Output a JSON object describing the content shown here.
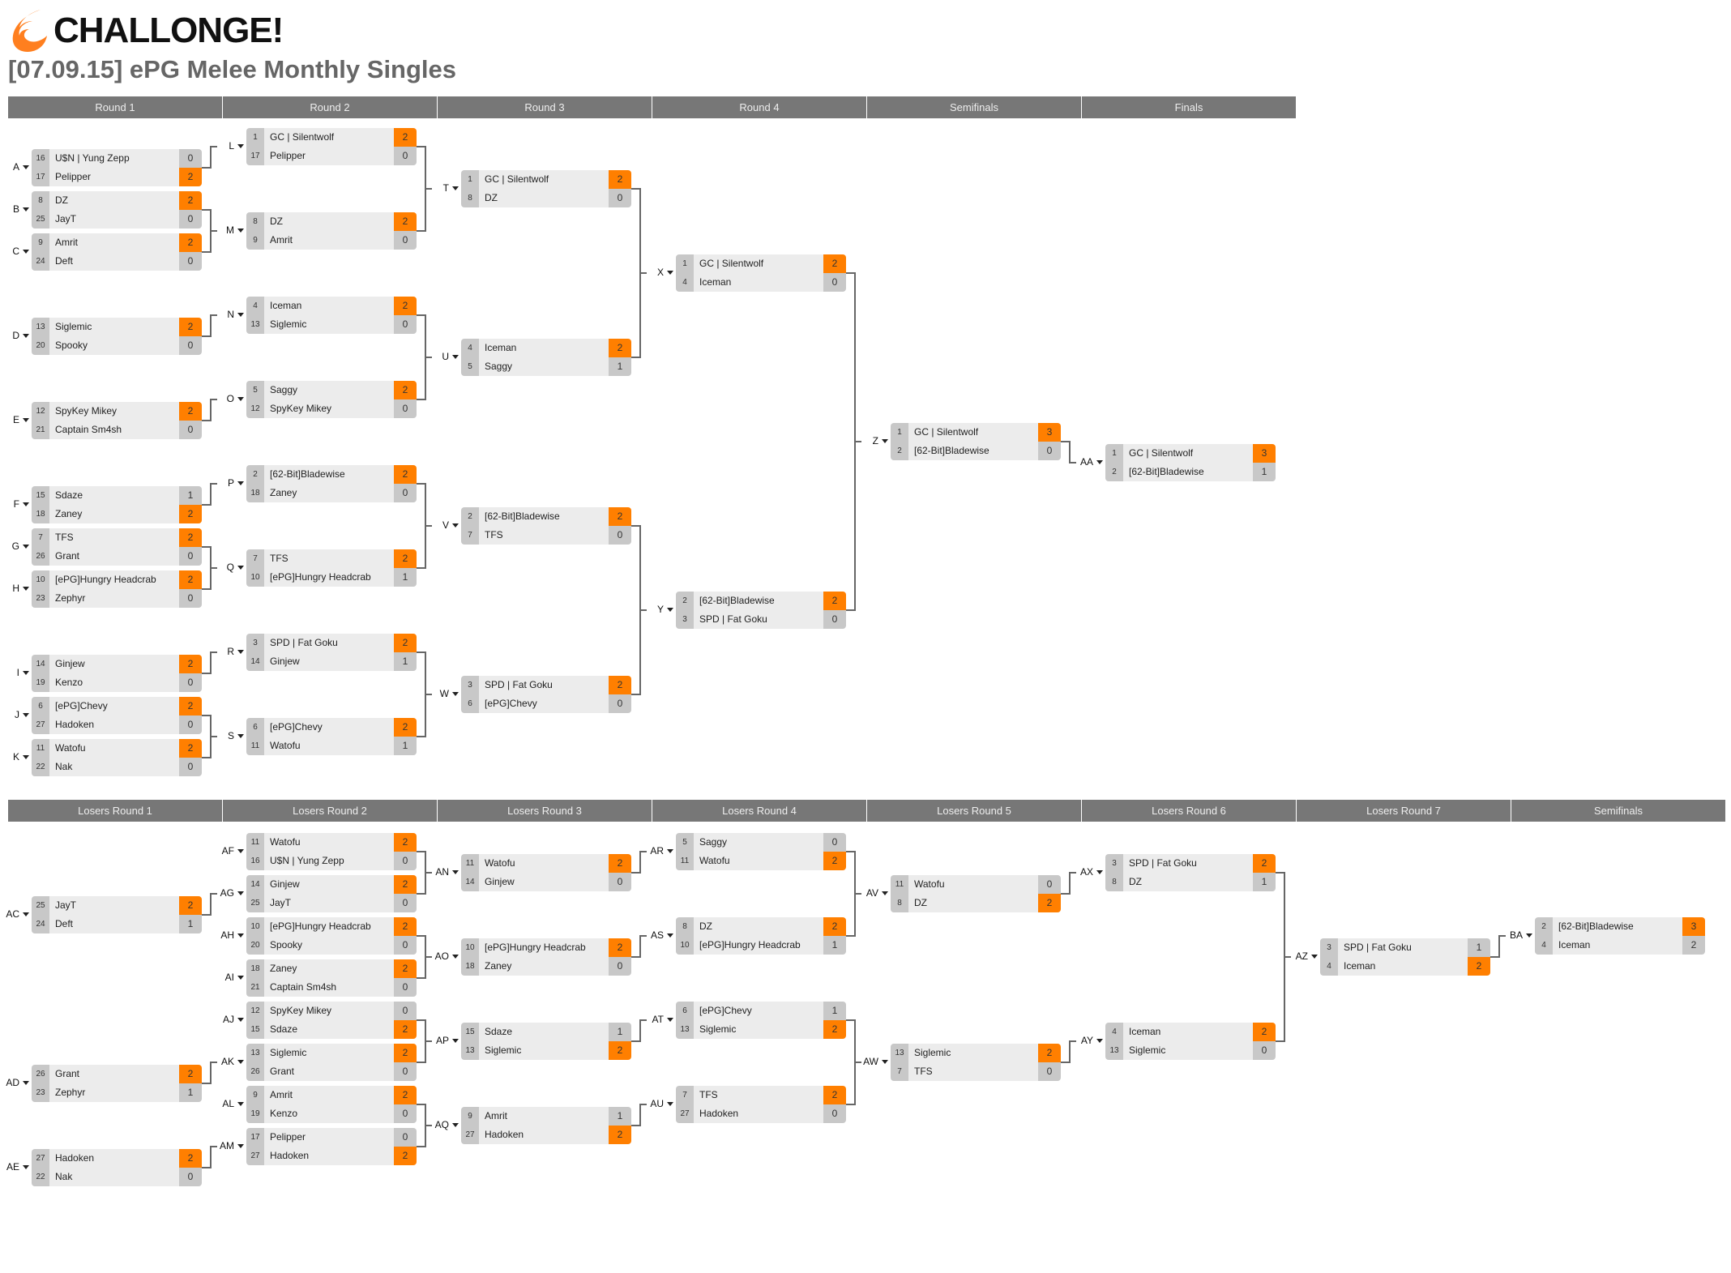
{
  "brand": {
    "name": "CHALLONGE!",
    "icon": "challonge-flame-logo-icon",
    "accent": "#ff7f00"
  },
  "tournament_title": "[07.09.15] ePG Melee Monthly Singles",
  "colors": {
    "header_bg": "#777777",
    "winner_score_bg": "#ff7f00",
    "seed_bg": "#c8c8c8",
    "name_bg": "#ececec"
  },
  "winners": {
    "rounds": [
      "Round 1",
      "Round 2",
      "Round 3",
      "Round 4",
      "Semifinals",
      "Finals"
    ],
    "matches": [
      {
        "id": "A",
        "round": 0,
        "p1": {
          "seed": 16,
          "name": "U$N | Yung Zepp",
          "score": 0
        },
        "p2": {
          "seed": 17,
          "name": "Pelipper",
          "score": 2
        },
        "winner": 2
      },
      {
        "id": "B",
        "round": 0,
        "p1": {
          "seed": 8,
          "name": "DZ",
          "score": 2
        },
        "p2": {
          "seed": 25,
          "name": "JayT",
          "score": 0
        },
        "winner": 1
      },
      {
        "id": "C",
        "round": 0,
        "p1": {
          "seed": 9,
          "name": "Amrit",
          "score": 2
        },
        "p2": {
          "seed": 24,
          "name": "Deft",
          "score": 0
        },
        "winner": 1
      },
      {
        "id": "D",
        "round": 0,
        "p1": {
          "seed": 13,
          "name": "Siglemic",
          "score": 2
        },
        "p2": {
          "seed": 20,
          "name": "Spooky",
          "score": 0
        },
        "winner": 1
      },
      {
        "id": "E",
        "round": 0,
        "p1": {
          "seed": 12,
          "name": "SpyKey Mikey",
          "score": 2
        },
        "p2": {
          "seed": 21,
          "name": "Captain Sm4sh",
          "score": 0
        },
        "winner": 1
      },
      {
        "id": "F",
        "round": 0,
        "p1": {
          "seed": 15,
          "name": "Sdaze",
          "score": 1
        },
        "p2": {
          "seed": 18,
          "name": "Zaney",
          "score": 2
        },
        "winner": 2
      },
      {
        "id": "G",
        "round": 0,
        "p1": {
          "seed": 7,
          "name": "TFS",
          "score": 2
        },
        "p2": {
          "seed": 26,
          "name": "Grant",
          "score": 0
        },
        "winner": 1
      },
      {
        "id": "H",
        "round": 0,
        "p1": {
          "seed": 10,
          "name": "[ePG]Hungry Headcrab",
          "score": 2
        },
        "p2": {
          "seed": 23,
          "name": "Zephyr",
          "score": 0
        },
        "winner": 1
      },
      {
        "id": "I",
        "round": 0,
        "p1": {
          "seed": 14,
          "name": "Ginjew",
          "score": 2
        },
        "p2": {
          "seed": 19,
          "name": "Kenzo",
          "score": 0
        },
        "winner": 1
      },
      {
        "id": "J",
        "round": 0,
        "p1": {
          "seed": 6,
          "name": "[ePG]Chevy",
          "score": 2
        },
        "p2": {
          "seed": 27,
          "name": "Hadoken",
          "score": 0
        },
        "winner": 1
      },
      {
        "id": "K",
        "round": 0,
        "p1": {
          "seed": 11,
          "name": "Watofu",
          "score": 2
        },
        "p2": {
          "seed": 22,
          "name": "Nak",
          "score": 0
        },
        "winner": 1
      },
      {
        "id": "L",
        "round": 1,
        "p1": {
          "seed": 1,
          "name": "GC | Silentwolf",
          "score": 2
        },
        "p2": {
          "seed": 17,
          "name": "Pelipper",
          "score": 0
        },
        "winner": 1
      },
      {
        "id": "M",
        "round": 1,
        "p1": {
          "seed": 8,
          "name": "DZ",
          "score": 2
        },
        "p2": {
          "seed": 9,
          "name": "Amrit",
          "score": 0
        },
        "winner": 1
      },
      {
        "id": "N",
        "round": 1,
        "p1": {
          "seed": 4,
          "name": "Iceman",
          "score": 2
        },
        "p2": {
          "seed": 13,
          "name": "Siglemic",
          "score": 0
        },
        "winner": 1
      },
      {
        "id": "O",
        "round": 1,
        "p1": {
          "seed": 5,
          "name": "Saggy",
          "score": 2
        },
        "p2": {
          "seed": 12,
          "name": "SpyKey Mikey",
          "score": 0
        },
        "winner": 1
      },
      {
        "id": "P",
        "round": 1,
        "p1": {
          "seed": 2,
          "name": "[62-Bit]Bladewise",
          "score": 2
        },
        "p2": {
          "seed": 18,
          "name": "Zaney",
          "score": 0
        },
        "winner": 1
      },
      {
        "id": "Q",
        "round": 1,
        "p1": {
          "seed": 7,
          "name": "TFS",
          "score": 2
        },
        "p2": {
          "seed": 10,
          "name": "[ePG]Hungry Headcrab",
          "score": 1
        },
        "winner": 1
      },
      {
        "id": "R",
        "round": 1,
        "p1": {
          "seed": 3,
          "name": "SPD | Fat Goku",
          "score": 2
        },
        "p2": {
          "seed": 14,
          "name": "Ginjew",
          "score": 1
        },
        "winner": 1
      },
      {
        "id": "S",
        "round": 1,
        "p1": {
          "seed": 6,
          "name": "[ePG]Chevy",
          "score": 2
        },
        "p2": {
          "seed": 11,
          "name": "Watofu",
          "score": 1
        },
        "winner": 1
      },
      {
        "id": "T",
        "round": 2,
        "p1": {
          "seed": 1,
          "name": "GC | Silentwolf",
          "score": 2
        },
        "p2": {
          "seed": 8,
          "name": "DZ",
          "score": 0
        },
        "winner": 1
      },
      {
        "id": "U",
        "round": 2,
        "p1": {
          "seed": 4,
          "name": "Iceman",
          "score": 2
        },
        "p2": {
          "seed": 5,
          "name": "Saggy",
          "score": 1
        },
        "winner": 1
      },
      {
        "id": "V",
        "round": 2,
        "p1": {
          "seed": 2,
          "name": "[62-Bit]Bladewise",
          "score": 2
        },
        "p2": {
          "seed": 7,
          "name": "TFS",
          "score": 0
        },
        "winner": 1
      },
      {
        "id": "W",
        "round": 2,
        "p1": {
          "seed": 3,
          "name": "SPD | Fat Goku",
          "score": 2
        },
        "p2": {
          "seed": 6,
          "name": "[ePG]Chevy",
          "score": 0
        },
        "winner": 1
      },
      {
        "id": "X",
        "round": 3,
        "p1": {
          "seed": 1,
          "name": "GC | Silentwolf",
          "score": 2
        },
        "p2": {
          "seed": 4,
          "name": "Iceman",
          "score": 0
        },
        "winner": 1
      },
      {
        "id": "Y",
        "round": 3,
        "p1": {
          "seed": 2,
          "name": "[62-Bit]Bladewise",
          "score": 2
        },
        "p2": {
          "seed": 3,
          "name": "SPD | Fat Goku",
          "score": 0
        },
        "winner": 1
      },
      {
        "id": "Z",
        "round": 4,
        "p1": {
          "seed": 1,
          "name": "GC | Silentwolf",
          "score": 3
        },
        "p2": {
          "seed": 2,
          "name": "[62-Bit]Bladewise",
          "score": 0
        },
        "winner": 1
      },
      {
        "id": "AA",
        "round": 5,
        "p1": {
          "seed": 1,
          "name": "GC | Silentwolf",
          "score": 3
        },
        "p2": {
          "seed": 2,
          "name": "[62-Bit]Bladewise",
          "score": 1
        },
        "winner": 1
      }
    ]
  },
  "losers": {
    "rounds": [
      "Losers Round 1",
      "Losers Round 2",
      "Losers Round 3",
      "Losers Round 4",
      "Losers Round 5",
      "Losers Round 6",
      "Losers Round 7",
      "Semifinals"
    ],
    "matches": [
      {
        "id": "AC",
        "round": 0,
        "p1": {
          "seed": 25,
          "name": "JayT",
          "score": 2
        },
        "p2": {
          "seed": 24,
          "name": "Deft",
          "score": 1
        },
        "winner": 1
      },
      {
        "id": "AD",
        "round": 0,
        "p1": {
          "seed": 26,
          "name": "Grant",
          "score": 2
        },
        "p2": {
          "seed": 23,
          "name": "Zephyr",
          "score": 1
        },
        "winner": 1
      },
      {
        "id": "AE",
        "round": 0,
        "p1": {
          "seed": 27,
          "name": "Hadoken",
          "score": 2
        },
        "p2": {
          "seed": 22,
          "name": "Nak",
          "score": 0
        },
        "winner": 1
      },
      {
        "id": "AF",
        "round": 1,
        "p1": {
          "seed": 11,
          "name": "Watofu",
          "score": 2
        },
        "p2": {
          "seed": 16,
          "name": "U$N | Yung Zepp",
          "score": 0
        },
        "winner": 1
      },
      {
        "id": "AG",
        "round": 1,
        "p1": {
          "seed": 14,
          "name": "Ginjew",
          "score": 2
        },
        "p2": {
          "seed": 25,
          "name": "JayT",
          "score": 0
        },
        "winner": 1
      },
      {
        "id": "AH",
        "round": 1,
        "p1": {
          "seed": 10,
          "name": "[ePG]Hungry Headcrab",
          "score": 2
        },
        "p2": {
          "seed": 20,
          "name": "Spooky",
          "score": 0
        },
        "winner": 1
      },
      {
        "id": "AI",
        "round": 1,
        "p1": {
          "seed": 18,
          "name": "Zaney",
          "score": 2
        },
        "p2": {
          "seed": 21,
          "name": "Captain Sm4sh",
          "score": 0
        },
        "winner": 1
      },
      {
        "id": "AJ",
        "round": 1,
        "p1": {
          "seed": 12,
          "name": "SpyKey Mikey",
          "score": 0
        },
        "p2": {
          "seed": 15,
          "name": "Sdaze",
          "score": 2
        },
        "winner": 2
      },
      {
        "id": "AK",
        "round": 1,
        "p1": {
          "seed": 13,
          "name": "Siglemic",
          "score": 2
        },
        "p2": {
          "seed": 26,
          "name": "Grant",
          "score": 0
        },
        "winner": 1
      },
      {
        "id": "AL",
        "round": 1,
        "p1": {
          "seed": 9,
          "name": "Amrit",
          "score": 2
        },
        "p2": {
          "seed": 19,
          "name": "Kenzo",
          "score": 0
        },
        "winner": 1
      },
      {
        "id": "AM",
        "round": 1,
        "p1": {
          "seed": 17,
          "name": "Pelipper",
          "score": 0
        },
        "p2": {
          "seed": 27,
          "name": "Hadoken",
          "score": 2
        },
        "winner": 2
      },
      {
        "id": "AN",
        "round": 2,
        "p1": {
          "seed": 11,
          "name": "Watofu",
          "score": 2
        },
        "p2": {
          "seed": 14,
          "name": "Ginjew",
          "score": 0
        },
        "winner": 1
      },
      {
        "id": "AO",
        "round": 2,
        "p1": {
          "seed": 10,
          "name": "[ePG]Hungry Headcrab",
          "score": 2
        },
        "p2": {
          "seed": 18,
          "name": "Zaney",
          "score": 0
        },
        "winner": 1
      },
      {
        "id": "AP",
        "round": 2,
        "p1": {
          "seed": 15,
          "name": "Sdaze",
          "score": 1
        },
        "p2": {
          "seed": 13,
          "name": "Siglemic",
          "score": 2
        },
        "winner": 2
      },
      {
        "id": "AQ",
        "round": 2,
        "p1": {
          "seed": 9,
          "name": "Amrit",
          "score": 1
        },
        "p2": {
          "seed": 27,
          "name": "Hadoken",
          "score": 2
        },
        "winner": 2
      },
      {
        "id": "AR",
        "round": 3,
        "p1": {
          "seed": 5,
          "name": "Saggy",
          "score": 0
        },
        "p2": {
          "seed": 11,
          "name": "Watofu",
          "score": 2
        },
        "winner": 2
      },
      {
        "id": "AS",
        "round": 3,
        "p1": {
          "seed": 8,
          "name": "DZ",
          "score": 2
        },
        "p2": {
          "seed": 10,
          "name": "[ePG]Hungry Headcrab",
          "score": 1
        },
        "winner": 1
      },
      {
        "id": "AT",
        "round": 3,
        "p1": {
          "seed": 6,
          "name": "[ePG]Chevy",
          "score": 1
        },
        "p2": {
          "seed": 13,
          "name": "Siglemic",
          "score": 2
        },
        "winner": 2
      },
      {
        "id": "AU",
        "round": 3,
        "p1": {
          "seed": 7,
          "name": "TFS",
          "score": 2
        },
        "p2": {
          "seed": 27,
          "name": "Hadoken",
          "score": 0
        },
        "winner": 1
      },
      {
        "id": "AV",
        "round": 4,
        "p1": {
          "seed": 11,
          "name": "Watofu",
          "score": 0
        },
        "p2": {
          "seed": 8,
          "name": "DZ",
          "score": 2
        },
        "winner": 2
      },
      {
        "id": "AW",
        "round": 4,
        "p1": {
          "seed": 13,
          "name": "Siglemic",
          "score": 2
        },
        "p2": {
          "seed": 7,
          "name": "TFS",
          "score": 0
        },
        "winner": 1
      },
      {
        "id": "AX",
        "round": 5,
        "p1": {
          "seed": 3,
          "name": "SPD | Fat Goku",
          "score": 2
        },
        "p2": {
          "seed": 8,
          "name": "DZ",
          "score": 1
        },
        "winner": 1
      },
      {
        "id": "AY",
        "round": 5,
        "p1": {
          "seed": 4,
          "name": "Iceman",
          "score": 2
        },
        "p2": {
          "seed": 13,
          "name": "Siglemic",
          "score": 0
        },
        "winner": 1
      },
      {
        "id": "AZ",
        "round": 6,
        "p1": {
          "seed": 3,
          "name": "SPD | Fat Goku",
          "score": 1
        },
        "p2": {
          "seed": 4,
          "name": "Iceman",
          "score": 2
        },
        "winner": 2
      },
      {
        "id": "BA",
        "round": 7,
        "p1": {
          "seed": 2,
          "name": "[62-Bit]Bladewise",
          "score": 3
        },
        "p2": {
          "seed": 4,
          "name": "Iceman",
          "score": 2
        },
        "winner": 1
      }
    ]
  }
}
